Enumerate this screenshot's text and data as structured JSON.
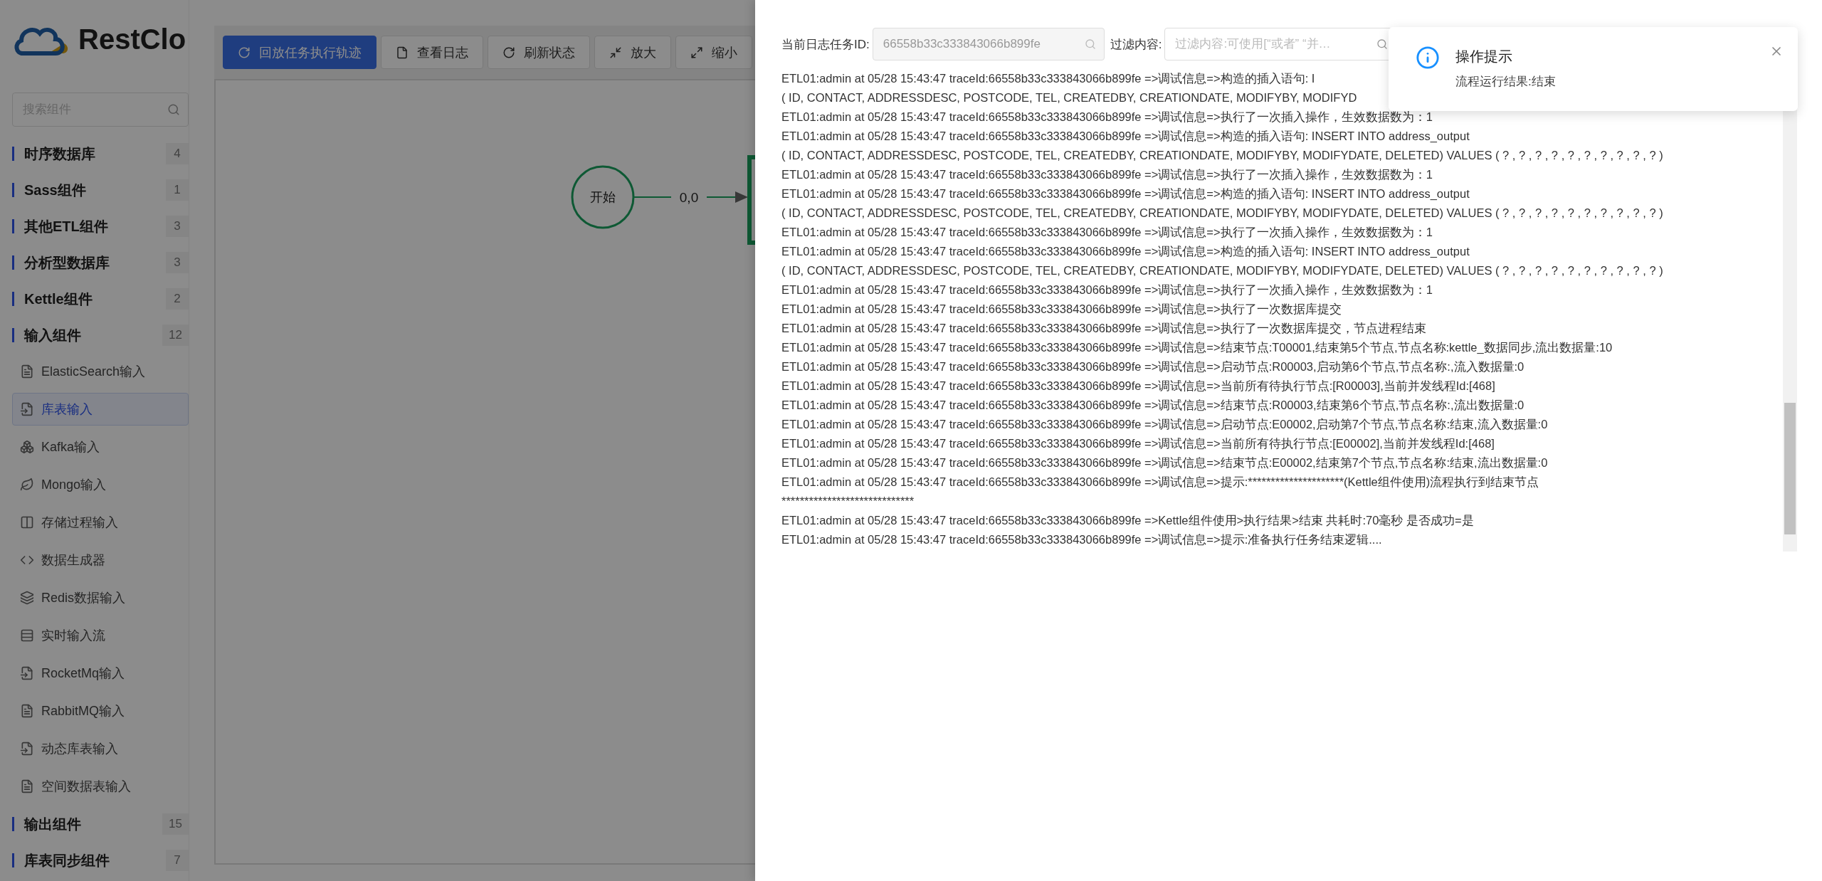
{
  "sidebar": {
    "logo_text": "RestClo",
    "search_placeholder": "搜索组件",
    "groups": [
      {
        "label": "时序数据库",
        "count": "4"
      },
      {
        "label": "Sass组件",
        "count": "1"
      },
      {
        "label": "其他ETL组件",
        "count": "3"
      },
      {
        "label": "分析型数据库",
        "count": "3"
      },
      {
        "label": "Kettle组件",
        "count": "2"
      },
      {
        "label": "输入组件",
        "count": "12",
        "children": [
          {
            "label": "ElasticSearch输入",
            "selected": false
          },
          {
            "label": "库表输入",
            "selected": true
          },
          {
            "label": "Kafka输入",
            "selected": false
          },
          {
            "label": "Mongo输入",
            "selected": false
          },
          {
            "label": "存储过程输入",
            "selected": false
          },
          {
            "label": "数据生成器",
            "selected": false
          },
          {
            "label": "Redis数据输入",
            "selected": false
          },
          {
            "label": "实时输入流",
            "selected": false
          },
          {
            "label": "RocketMq输入",
            "selected": false
          },
          {
            "label": "RabbitMQ输入",
            "selected": false
          },
          {
            "label": "动态库表输入",
            "selected": false
          },
          {
            "label": "空间数据表输入",
            "selected": false
          }
        ]
      },
      {
        "label": "输出组件",
        "count": "15"
      },
      {
        "label": "库表同步组件",
        "count": "7"
      }
    ]
  },
  "toolbar": [
    {
      "label": "回放任务执行轨迹",
      "kind": "primary"
    },
    {
      "label": "查看日志",
      "kind": "default"
    },
    {
      "label": "刷新状态",
      "kind": "default"
    },
    {
      "label": "放大",
      "kind": "default"
    },
    {
      "label": "缩小",
      "kind": "default"
    }
  ],
  "canvas": {
    "start_node": "开始",
    "edge_label": "0,0"
  },
  "log_drawer": {
    "task_id_label": "当前日志任务ID:",
    "task_id_value": "66558b33c333843066b899fe",
    "filter_label": "过滤内容:",
    "filter_placeholder": "过滤内容:可使用[“或者” “并…",
    "lines": [
      "ETL01:admin at 05/28 15:43:47 traceId:66558b33c333843066b899fe =>调试信息=>构造的插入语句: I",
      "( ID, CONTACT, ADDRESSDESC, POSTCODE, TEL, CREATEDBY, CREATIONDATE, MODIFYBY, MODIFYD",
      "ETL01:admin at 05/28 15:43:47 traceId:66558b33c333843066b899fe =>调试信息=>执行了一次插入操作，生效数据数为：1",
      "ETL01:admin at 05/28 15:43:47 traceId:66558b33c333843066b899fe =>调试信息=>构造的插入语句: INSERT INTO address_output",
      "( ID, CONTACT, ADDRESSDESC, POSTCODE, TEL, CREATEDBY, CREATIONDATE, MODIFYBY, MODIFYDATE, DELETED) VALUES ( ? , ? , ? , ? , ? , ? , ? , ? , ? , ? )",
      "ETL01:admin at 05/28 15:43:47 traceId:66558b33c333843066b899fe =>调试信息=>执行了一次插入操作，生效数据数为：1",
      "ETL01:admin at 05/28 15:43:47 traceId:66558b33c333843066b899fe =>调试信息=>构造的插入语句: INSERT INTO address_output",
      "( ID, CONTACT, ADDRESSDESC, POSTCODE, TEL, CREATEDBY, CREATIONDATE, MODIFYBY, MODIFYDATE, DELETED) VALUES ( ? , ? , ? , ? , ? , ? , ? , ? , ? , ? )",
      "ETL01:admin at 05/28 15:43:47 traceId:66558b33c333843066b899fe =>调试信息=>执行了一次插入操作，生效数据数为：1",
      "ETL01:admin at 05/28 15:43:47 traceId:66558b33c333843066b899fe =>调试信息=>构造的插入语句: INSERT INTO address_output",
      "( ID, CONTACT, ADDRESSDESC, POSTCODE, TEL, CREATEDBY, CREATIONDATE, MODIFYBY, MODIFYDATE, DELETED) VALUES ( ? , ? , ? , ? , ? , ? , ? , ? , ? , ? )",
      "ETL01:admin at 05/28 15:43:47 traceId:66558b33c333843066b899fe =>调试信息=>执行了一次插入操作，生效数据数为：1",
      "ETL01:admin at 05/28 15:43:47 traceId:66558b33c333843066b899fe =>调试信息=>执行了一次数据库提交",
      "ETL01:admin at 05/28 15:43:47 traceId:66558b33c333843066b899fe =>调试信息=>执行了一次数据库提交，节点进程结束",
      "ETL01:admin at 05/28 15:43:47 traceId:66558b33c333843066b899fe =>调试信息=>结束节点:T00001,结束第5个节点,节点名称:kettle_数据同步,流出数据量:10",
      "ETL01:admin at 05/28 15:43:47 traceId:66558b33c333843066b899fe =>调试信息=>启动节点:R00003,启动第6个节点,节点名称:,流入数据量:0",
      "ETL01:admin at 05/28 15:43:47 traceId:66558b33c333843066b899fe =>调试信息=>当前所有待执行节点:[R00003],当前并发线程Id:[468]",
      "ETL01:admin at 05/28 15:43:47 traceId:66558b33c333843066b899fe =>调试信息=>结束节点:R00003,结束第6个节点,节点名称:,流出数据量:0",
      "ETL01:admin at 05/28 15:43:47 traceId:66558b33c333843066b899fe =>调试信息=>启动节点:E00002,启动第7个节点,节点名称:结束,流入数据量:0",
      "ETL01:admin at 05/28 15:43:47 traceId:66558b33c333843066b899fe =>调试信息=>当前所有待执行节点:[E00002],当前并发线程Id:[468]",
      "ETL01:admin at 05/28 15:43:47 traceId:66558b33c333843066b899fe =>调试信息=>结束节点:E00002,结束第7个节点,节点名称:结束,流出数据量:0",
      "ETL01:admin at 05/28 15:43:47 traceId:66558b33c333843066b899fe =>调试信息=>提示:*********************(Kettle组件使用)流程执行到结束节点",
      "*****************************",
      "ETL01:admin at 05/28 15:43:47 traceId:66558b33c333843066b899fe =>Kettle组件使用>执行结果>结束 共耗时:70毫秒 是否成功=是",
      "ETL01:admin at 05/28 15:43:47 traceId:66558b33c333843066b899fe =>调试信息=>提示:准备执行任务结束逻辑...."
    ]
  },
  "notification": {
    "title": "操作提示",
    "message": "流程运行结果:结束"
  }
}
